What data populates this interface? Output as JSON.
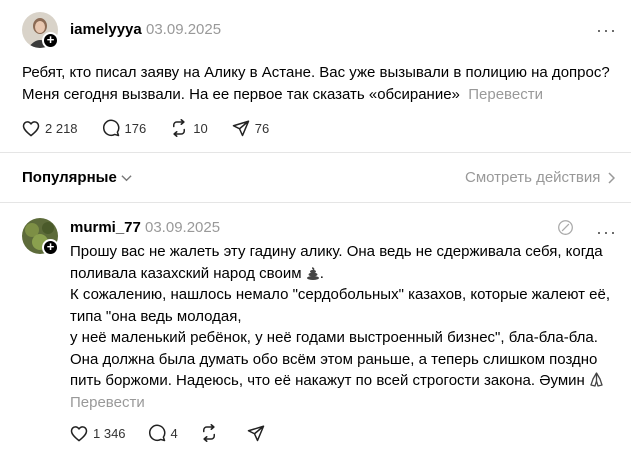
{
  "post": {
    "username": "iamelyyya",
    "date": "03.09.2025",
    "text_lines": [
      "Ребят, кто писал заяву на Алику в Астане. Вас уже вызывали в полицию на допрос?",
      "Меня сегодня вызвали. На ее первое так сказать «обсирание»"
    ],
    "translate_label": "Перевести",
    "likes": "2 218",
    "comments": "176",
    "reposts": "10",
    "shares": "76"
  },
  "sort_bar": {
    "label": "Популярные",
    "view_activity": "Смотреть действия"
  },
  "comment": {
    "username": "murmi_77",
    "date": "03.09.2025",
    "line1": "Прошу вас не жалеть эту гадину алику. Она ведь не сдерживала себя, когда",
    "line2": "поливала казахский народ своим",
    "line2_end": ".",
    "line3": "К сожалению, нашлось немало \"сердобольных\" казахов, которые жалеют её,",
    "line4": "типа \"она ведь молодая,",
    "line5": "у неё маленький ребёнок, у неё годами выстроенный бизнес\", бла-бла-бла.",
    "line6": "Она должна была думать обо всём этом раньше, а теперь слишком поздно",
    "line7": "пить боржоми. Надеюсь, что её накажут по всей строгости закона. Әумин",
    "translate_label": "Перевести",
    "likes": "1 346",
    "comments": "4"
  },
  "icons": {
    "more": "more-horizontal-icon",
    "like": "heart-icon",
    "comment": "speech-bubble-icon",
    "repost": "repost-icon",
    "share": "send-icon",
    "chevron": "chevron-down-icon",
    "chevron_right": "chevron-right-icon",
    "edit": "edit-circle-icon",
    "emoji_poop": "poop-emoji-icon",
    "emoji_pray": "praying-emoji-icon"
  },
  "colors": {
    "text": "#000000",
    "muted": "#999999",
    "divider": "#e5e5e5"
  }
}
